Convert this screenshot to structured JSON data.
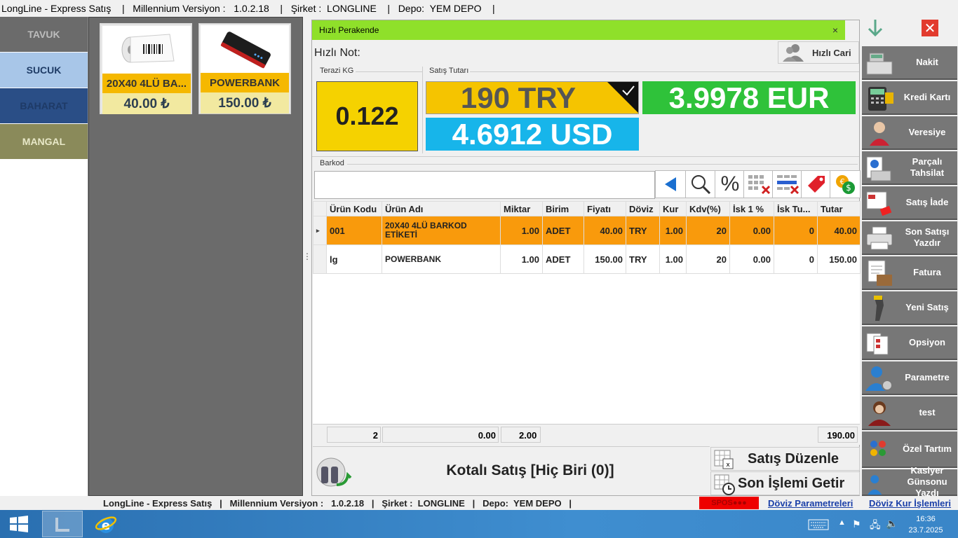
{
  "titlebar": {
    "text": "LongLine - Express Satış    |   Millennium Versiyon :   1.0.2.18    |   Şirket :  LONGLINE    |   Depo:  YEM DEPO    |"
  },
  "categories": [
    {
      "label": "TAVUK",
      "bg": "#6b6b6b",
      "fg": "#bdbdbd"
    },
    {
      "label": "SUCUK",
      "bg": "#a8c6e8",
      "fg": "#1f3c66"
    },
    {
      "label": "BAHARAT",
      "bg": "#2a4e86",
      "fg": "#1e3a66"
    },
    {
      "label": "MANGAL",
      "bg": "#8a8a5a",
      "fg": "#e8e8c8"
    }
  ],
  "products": [
    {
      "name": "20X40 4LÜ BA...",
      "price": "40.00 ₺",
      "icon": "label-printer-icon"
    },
    {
      "name": "POWERBANK",
      "price": "150.00 ₺",
      "icon": "powerbank-icon"
    }
  ],
  "panel": {
    "title": "Hızlı Perakende",
    "close": "×",
    "quick_note_label": "Hızlı Not:",
    "quick_account": "Hızlı Cari",
    "scale_group": "Terazi KG",
    "scale_value": "0.122",
    "sale_group": "Satış Tutarı",
    "try_total": "190 TRY",
    "eur_total": "3.9978 EUR",
    "usd_total": "4.6912 USD",
    "barcode_group": "Barkod",
    "barcode_value": ""
  },
  "grid": {
    "columns": [
      "Ürün Kodu",
      "Ürün Adı",
      "Miktar",
      "Birim",
      "Fiyatı",
      "Döviz",
      "Kur",
      "Kdv(%)",
      "İsk 1 %",
      "İsk Tu...",
      "Tutar"
    ],
    "rows": [
      {
        "code": "001",
        "name": "20X40 4LÜ BARKOD ETİKETİ",
        "qty": "1.00",
        "unit": "ADET",
        "price": "40.00",
        "cur": "TRY",
        "rate": "1.00",
        "vat": "20",
        "disc1": "0.00",
        "disc_amt": "0",
        "total": "40.00"
      },
      {
        "code": "lg",
        "name": "POWERBANK",
        "qty": "1.00",
        "unit": "ADET",
        "price": "150.00",
        "cur": "TRY",
        "rate": "1.00",
        "vat": "20",
        "disc1": "0.00",
        "disc_amt": "0",
        "total": "150.00"
      }
    ],
    "footer": {
      "count": "2",
      "sum_a": "0.00",
      "sum_qty": "2.00",
      "sum_total": "190.00"
    }
  },
  "bottom": {
    "quota_sale": "Kotalı Satış [Hiç Biri (0)]",
    "edit_sale": "Satış Düzenle",
    "last_op": "Son İşlemi Getir"
  },
  "right_buttons": [
    {
      "label": "Nakit",
      "icon": "cash-register-icon"
    },
    {
      "label": "Kredi Kartı",
      "icon": "card-terminal-icon"
    },
    {
      "label": "Veresiye",
      "icon": "customer-icon"
    },
    {
      "label": "Parçalı Tahsilat",
      "icon": "split-payment-icon"
    },
    {
      "label": "Satış İade",
      "icon": "return-icon"
    },
    {
      "label": "Son Satışı Yazdır",
      "icon": "printer-icon"
    },
    {
      "label": "Fatura",
      "icon": "invoice-icon"
    },
    {
      "label": "Yeni Satış",
      "icon": "scanner-icon"
    },
    {
      "label": "Opsiyon",
      "icon": "options-icon"
    },
    {
      "label": "Parametre",
      "icon": "user-gear-icon"
    },
    {
      "label": "test",
      "icon": "user-icon"
    },
    {
      "label": "Özel Tartım",
      "icon": "dots-icon"
    },
    {
      "label": "Kasiyer Günsonu Yazdı",
      "icon": "cashier-icon"
    }
  ],
  "status": {
    "left": "LongLine - Express Satış   |   Millennium Versiyon :   1.0.2.18   |   Şirket :  LONGLINE   |   Depo:  YEM DEPO   |",
    "spos": "SPOS●●●",
    "fx_params": "Döviz Parametreleri",
    "fx_ops": "Döviz Kur İşlemleri"
  },
  "taskbar": {
    "time": "16:36",
    "date": "23.7.2025"
  },
  "colors": {
    "accent_green": "#8fe02a",
    "try_yellow": "#f5c400",
    "eur_green": "#2fc23a",
    "usd_cyan": "#17b5ea",
    "row_orange": "#f99a0c"
  }
}
